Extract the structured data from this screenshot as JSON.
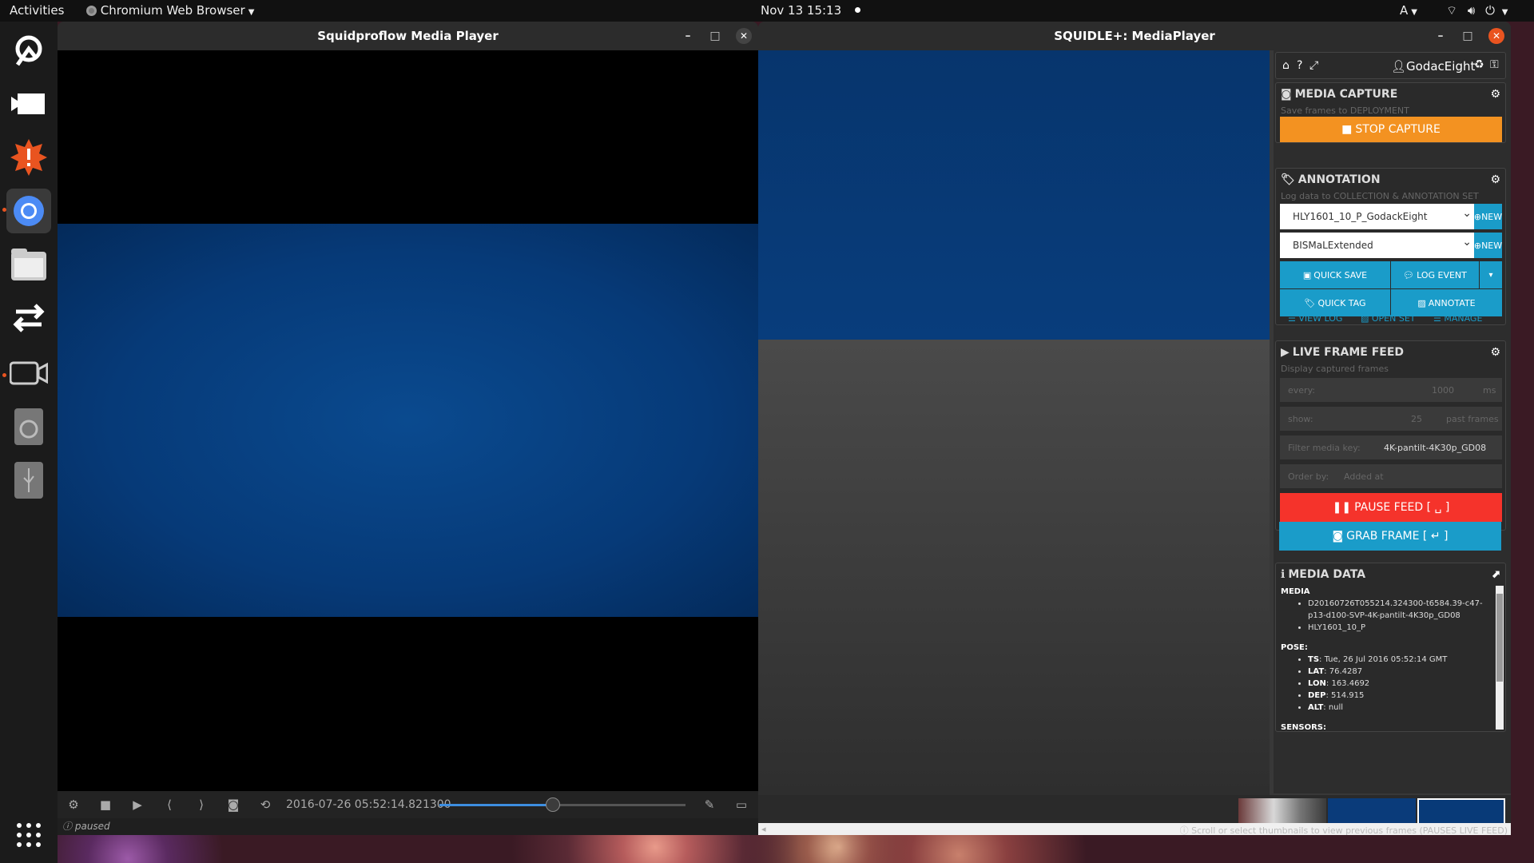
{
  "topbar": {
    "activities": "Activities",
    "app_name": "Chromium Web Browser",
    "datetime": "Nov 13  15:13",
    "keyboard": "A"
  },
  "dock": {
    "icons": [
      "squidle-icon",
      "video-player-icon",
      "alert-app-icon",
      "chromium-icon",
      "files-icon",
      "transfer-icon",
      "camera-icon",
      "disk-icon",
      "usb-icon",
      "app-grid-icon"
    ]
  },
  "player1": {
    "title": "Squidproflow Media Player",
    "timestamp": "2016-07-26 05:52:14.821300",
    "status": "paused",
    "seek_progress": 0.46
  },
  "player2": {
    "title": "SQUIDLE+: MediaPlayer",
    "user": "GodacEight",
    "media_capture": {
      "heading": "MEDIA CAPTURE",
      "subtitle": "Save frames to DEPLOYMENT",
      "stop_label": "STOP CAPTURE"
    },
    "annotation": {
      "heading": "ANNOTATION",
      "subtitle": "Log data to COLLECTION & ANNOTATION SET",
      "collection": "HLY1601_10_P_GodackEight",
      "label_scheme": "BISMaLExtended",
      "new_label": "NEW",
      "quick_save": "QUICK SAVE",
      "log_event": "LOG EVENT",
      "quick_tag": "QUICK TAG",
      "annotate": "ANNOTATE",
      "view_log": "VIEW LOG",
      "open_set": "OPEN SET",
      "manage": "MANAGE"
    },
    "live_feed": {
      "heading": "LIVE FRAME FEED",
      "subtitle": "Display captured frames",
      "every_label": "every:",
      "every_value": "1000",
      "every_unit": "ms",
      "show_label": "show:",
      "show_value": "25",
      "show_unit": "past frames",
      "filter_label": "Filter media key:",
      "filter_value": "4K-pantilt-4K30p_GD08",
      "order_label": "Order by:",
      "order_value": "Added at",
      "pause_label": "PAUSE FEED [ ␣ ]",
      "grab_label": "GRAB FRAME [ ↵ ]"
    },
    "media_data": {
      "heading": "MEDIA DATA",
      "media_label": "MEDIA",
      "media_items": [
        "D20160726T055214.324300-t6584.39-c47-p13-d100-SVP-4K-pantilt-4K30p_GD08",
        "HLY1601_10_P"
      ],
      "pose_label": "POSE:",
      "pose": [
        {
          "key": "TS",
          "value": "Tue, 26 Jul 2016 05:52:14 GMT"
        },
        {
          "key": "LAT",
          "value": "76.4287"
        },
        {
          "key": "LON",
          "value": "163.4692"
        },
        {
          "key": "DEP",
          "value": "514.915"
        },
        {
          "key": "ALT",
          "value": "null"
        }
      ],
      "sensors_label": "SENSORS:"
    },
    "scroll_hint": "Scroll or select thumbnails to view previous frames (PAUSES LIVE FEED)"
  }
}
